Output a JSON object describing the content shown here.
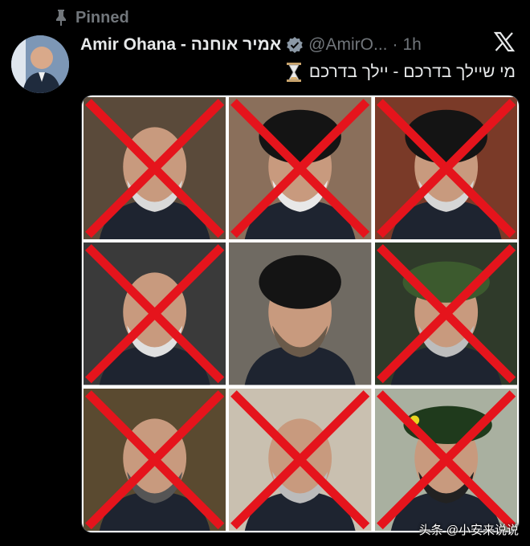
{
  "pinned": {
    "label": "Pinned"
  },
  "author": {
    "name": "Amir Ohana - אמיר אוחנה",
    "handle": "@AmirO...",
    "separator": "·",
    "time": "1h"
  },
  "tweet": {
    "text": "מי שיילך בדרכם - יילך בדרכם"
  },
  "icons": {
    "pin": "pin-icon",
    "verified": "verified-badge-icon",
    "x_logo": "x-logo-icon",
    "hourglass": "hourglass-icon"
  },
  "media": {
    "cells": [
      {
        "crossed": true,
        "bg": "#5a4a3a",
        "headwear": "none",
        "beard": "#d9d9d9"
      },
      {
        "crossed": true,
        "bg": "#8a6f5b",
        "headwear": "turban",
        "beard": "#e8e8e8"
      },
      {
        "crossed": true,
        "bg": "#7a3a28",
        "headwear": "turban",
        "beard": "#d6d6d6"
      },
      {
        "crossed": true,
        "bg": "#3a3a3a",
        "headwear": "none",
        "beard": "#e0e0e0"
      },
      {
        "crossed": false,
        "bg": "#6f6a62",
        "headwear": "turban",
        "beard": "#6a5a4a"
      },
      {
        "crossed": true,
        "bg": "#2f3a2a",
        "headwear": "cap",
        "beard": "#bdbdbd"
      },
      {
        "crossed": true,
        "bg": "#5a4a30",
        "headwear": "none",
        "beard": "#555"
      },
      {
        "crossed": true,
        "bg": "#c9c0b0",
        "headwear": "none",
        "beard": "#bbb"
      },
      {
        "crossed": true,
        "bg": "#a9b0a0",
        "headwear": "beret",
        "beard": "#222"
      }
    ],
    "x_color": "#e5141c"
  },
  "watermark": {
    "text": "头条 @小安来说说"
  }
}
